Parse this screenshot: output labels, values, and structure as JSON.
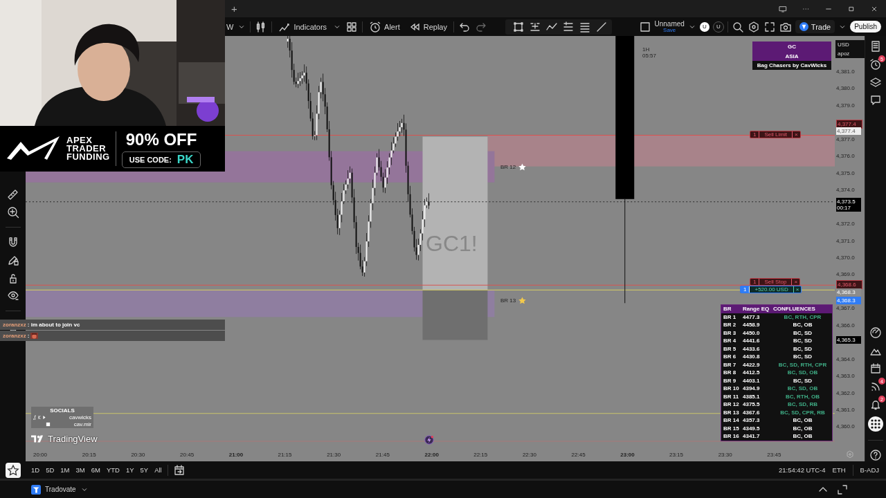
{
  "top_bar": {
    "new_tab": "+"
  },
  "toolbar": {
    "symbol_fragment": "W",
    "indicators": "Indicators",
    "alert": "Alert",
    "replay": "Replay",
    "layout_name": "Unnamed",
    "save": "Save",
    "avatars": [
      "U",
      "U"
    ],
    "trade": "Trade",
    "publish": "Publish"
  },
  "ad_banner": {
    "brand_lines": [
      "APEX",
      "TRADER",
      "FUNDING"
    ],
    "offer": "90% OFF",
    "code_label": "USE CODE:",
    "code": "PK"
  },
  "chat": [
    {
      "user": "zoranzxz",
      "message": ": im about to join vc",
      "emote": false
    },
    {
      "user": "zoranzxz",
      "message": ":",
      "emote": true
    }
  ],
  "socials": {
    "title": "SOCIALS",
    "handles": [
      "cavwicks",
      "cav.mir"
    ]
  },
  "chart": {
    "symbol_watermark": "GC1!",
    "bar_timer": [
      "1H",
      "05:57"
    ],
    "logo": "TradingView",
    "indicator_box": {
      "lines": [
        "GC",
        "ASIA"
      ],
      "footer": "Bag Chasers by CavWicks"
    },
    "zone_labels": [
      {
        "text": "BR 12",
        "color": "#ffffff"
      },
      {
        "text": "BR 13",
        "color": "#f2c94c"
      }
    ],
    "orders": [
      {
        "kind": "sell_limit",
        "qty": "1",
        "label": "Sell Limit",
        "close": "×"
      },
      {
        "kind": "sell_stop",
        "qty": "1",
        "label": "Sell Stop",
        "close": "×"
      },
      {
        "kind": "position",
        "qty": "1",
        "label": "+520.00 USD",
        "close": "×"
      }
    ],
    "levels_table": {
      "columns": [
        "BR",
        "Range EQ",
        "CONFLUENCES"
      ],
      "rows": [
        {
          "br": "BR 1",
          "eq": "4477.3",
          "confluences": "BC, RTH, CPR",
          "color": "#3fae86"
        },
        {
          "br": "BR 2",
          "eq": "4458.9",
          "confluences": "BC, OB",
          "color": "#ffffff"
        },
        {
          "br": "BR 3",
          "eq": "4450.0",
          "confluences": "BC, SD",
          "color": "#ffffff"
        },
        {
          "br": "BR 4",
          "eq": "4441.6",
          "confluences": "BC, SD",
          "color": "#ffffff"
        },
        {
          "br": "BR 5",
          "eq": "4433.6",
          "confluences": "BC, SD",
          "color": "#ffffff"
        },
        {
          "br": "BR 6",
          "eq": "4430.8",
          "confluences": "BC, SD",
          "color": "#ffffff"
        },
        {
          "br": "BR 7",
          "eq": "4422.9",
          "confluences": "BC, SD, RTH, CPR",
          "color": "#3fae86"
        },
        {
          "br": "BR 8",
          "eq": "4412.5",
          "confluences": "BC, SD, OB",
          "color": "#3fae86"
        },
        {
          "br": "BR 9",
          "eq": "4403.1",
          "confluences": "BC, SD",
          "color": "#ffffff"
        },
        {
          "br": "BR 10",
          "eq": "4394.9",
          "confluences": "BC, SD, OB",
          "color": "#3fae86"
        },
        {
          "br": "BR 11",
          "eq": "4385.1",
          "confluences": "BC, RTH, OB",
          "color": "#3fae86"
        },
        {
          "br": "BR 12",
          "eq": "4375.5",
          "confluences": "BC, SD, RB",
          "color": "#3fae86"
        },
        {
          "br": "BR 13",
          "eq": "4367.6",
          "confluences": "BC, SD, CPR, RB",
          "color": "#3fae86"
        },
        {
          "br": "BR 14",
          "eq": "4357.3",
          "confluences": "BC, OB",
          "color": "#ffffff"
        },
        {
          "br": "BR 15",
          "eq": "4349.5",
          "confluences": "BC, OB",
          "color": "#ffffff"
        },
        {
          "br": "BR 16",
          "eq": "4341.7",
          "confluences": "BC, OB",
          "color": "#ffffff"
        }
      ]
    }
  },
  "price_scale": {
    "currency": "USD",
    "unit": "apoz",
    "ticks": [
      "4,381.0",
      "4,380.0",
      "4,379.0",
      "4,377.0",
      "4,376.0",
      "4,375.0",
      "4,374.0",
      "4,372.0",
      "4,371.0",
      "4,370.0",
      "4,369.0",
      "4,367.0",
      "4,366.0",
      "4,364.0",
      "4,363.0",
      "4,362.0",
      "4,361.0",
      "4,360.0"
    ],
    "tags": [
      {
        "kind": "order",
        "text": "4,377.4"
      },
      {
        "kind": "ask",
        "text": "4,377.4"
      },
      {
        "kind": "last",
        "text": "4,373.5",
        "sub": "00:17"
      },
      {
        "kind": "order",
        "text": "4,368.6"
      },
      {
        "kind": "plain",
        "text": "4,368.3"
      },
      {
        "kind": "position",
        "text": "4,368.3"
      },
      {
        "kind": "last",
        "text": "4,365.3"
      }
    ]
  },
  "time_scale": [
    {
      "label": "20:00",
      "major": false
    },
    {
      "label": "20:15",
      "major": false
    },
    {
      "label": "20:30",
      "major": false
    },
    {
      "label": "20:45",
      "major": false
    },
    {
      "label": "21:00",
      "major": true
    },
    {
      "label": "21:15",
      "major": false
    },
    {
      "label": "21:30",
      "major": false
    },
    {
      "label": "21:45",
      "major": false
    },
    {
      "label": "22:00",
      "major": true
    },
    {
      "label": "22:15",
      "major": false
    },
    {
      "label": "22:30",
      "major": false
    },
    {
      "label": "22:45",
      "major": false
    },
    {
      "label": "23:00",
      "major": true
    },
    {
      "label": "23:15",
      "major": false
    },
    {
      "label": "23:30",
      "major": false
    },
    {
      "label": "23:45",
      "major": false
    }
  ],
  "range_buttons": [
    "1D",
    "5D",
    "1M",
    "3M",
    "6M",
    "YTD",
    "1Y",
    "5Y",
    "All"
  ],
  "status": {
    "clock": "21:54:42 UTC-4",
    "session": "ETH",
    "adjustment": "B-ADJ"
  },
  "right_sidebar": {
    "alerts_badge": "5",
    "feed_badge": "4",
    "notifications_badge": "2"
  },
  "bottom_panel": {
    "broker": "Tradovate"
  }
}
